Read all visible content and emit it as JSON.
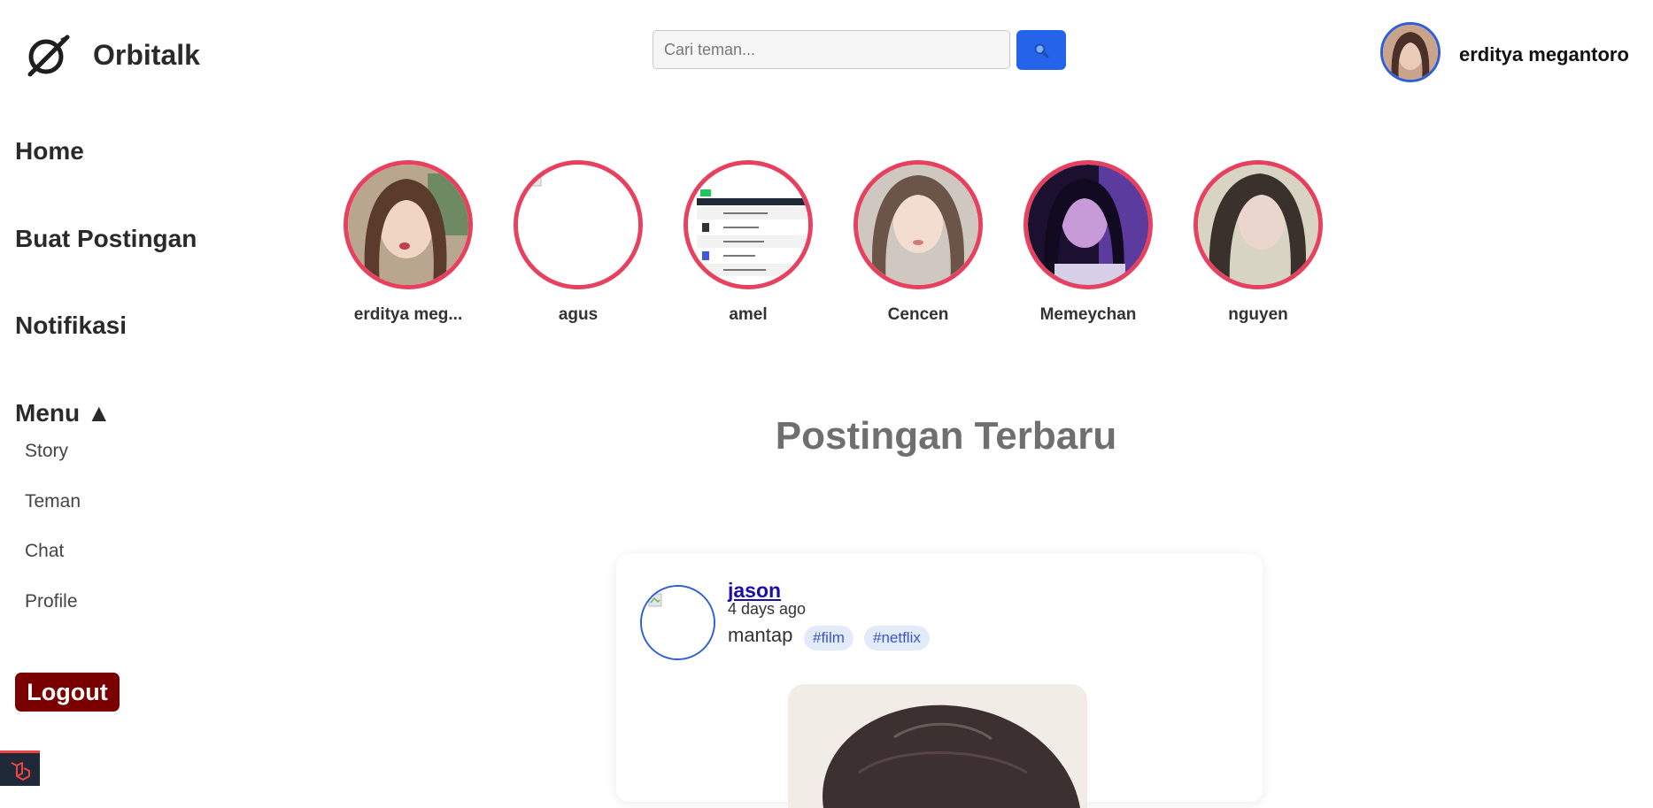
{
  "app": {
    "title": "Orbitalk",
    "logo_icon": "orbit-slash-logo-icon"
  },
  "search": {
    "placeholder": "Cari teman...",
    "button_icon": "search-icon"
  },
  "header": {
    "user_name": "erditya megantoro"
  },
  "sidebar": {
    "items": [
      {
        "label": "Home"
      },
      {
        "label": "Buat Postingan"
      },
      {
        "label": "Notifikasi"
      }
    ],
    "menu": {
      "label": "Menu ▲",
      "items": [
        {
          "label": "Story"
        },
        {
          "label": "Teman"
        },
        {
          "label": "Chat"
        },
        {
          "label": "Profile"
        }
      ]
    },
    "logout_label": "Logout"
  },
  "stories": [
    {
      "name": "erditya meg..."
    },
    {
      "name": "agus"
    },
    {
      "name": "amel"
    },
    {
      "name": "Cencen"
    },
    {
      "name": "Memeychan"
    },
    {
      "name": "nguyen"
    }
  ],
  "feed": {
    "title": "Postingan Terbaru",
    "posts": [
      {
        "author": "jason",
        "time": "4 days ago",
        "text": "mantap",
        "tags": [
          "#film",
          "#netflix"
        ]
      }
    ]
  },
  "colors": {
    "accent": "#2563eb",
    "story_ring": "#e8405f",
    "logout": "#7a0000",
    "tag_bg": "#e3ebfb"
  }
}
